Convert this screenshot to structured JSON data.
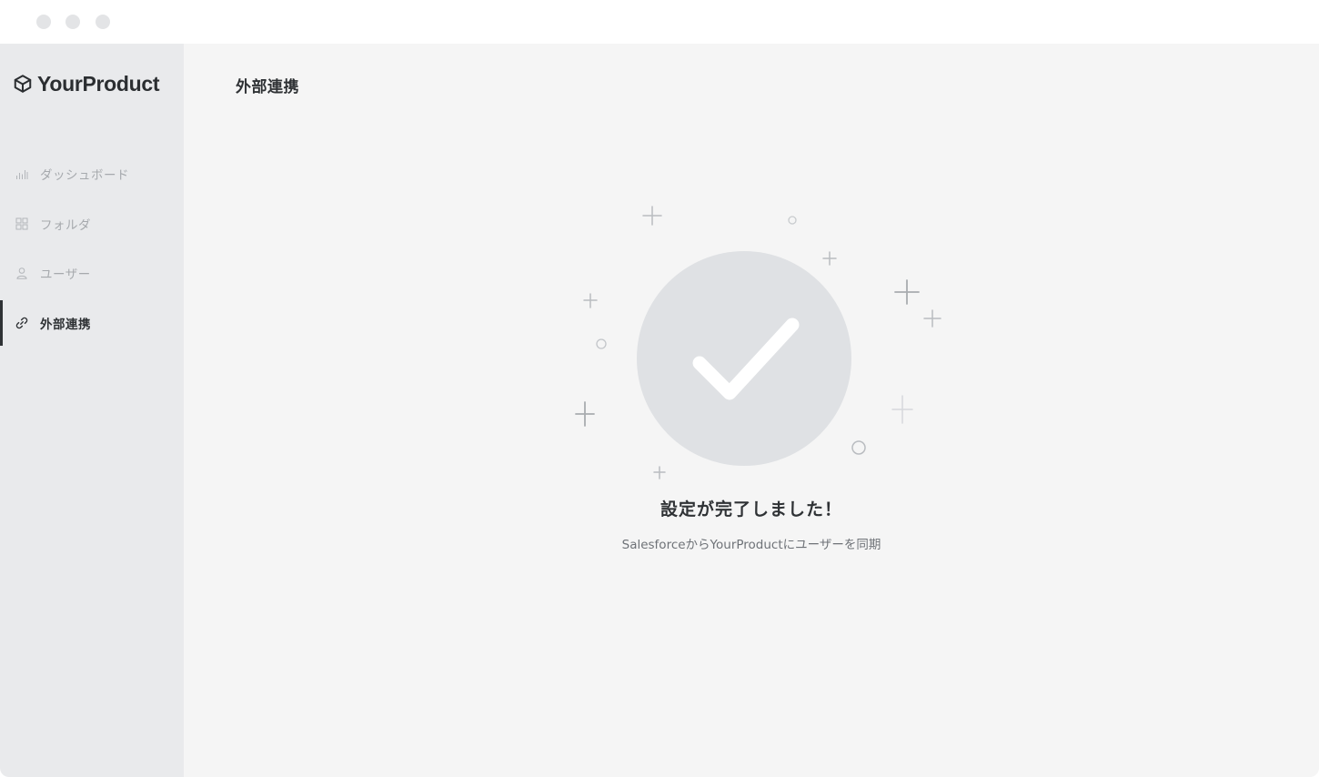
{
  "window": {
    "controls": [
      "close",
      "minimize",
      "maximize"
    ]
  },
  "sidebar": {
    "logo_icon": "cube-icon",
    "logo_text": "YourProduct",
    "items": [
      {
        "label": "ダッシュボード",
        "icon": "bar-chart-icon",
        "active": false
      },
      {
        "label": "フォルダ",
        "icon": "grid-icon",
        "active": false
      },
      {
        "label": "ユーザー",
        "icon": "user-icon",
        "active": false
      },
      {
        "label": "外部連携",
        "icon": "link-icon",
        "active": true
      }
    ]
  },
  "main": {
    "page_title": "外部連携",
    "status": {
      "icon": "checkmark-icon",
      "title": "設定が完了しました！",
      "subtitle": "SalesforceからYourProductにユーザーを同期"
    }
  },
  "colors": {
    "sidebar_bg": "#e9eaec",
    "main_bg": "#f5f5f5",
    "accent": "#2f3235",
    "check_circle": "#dfe1e4"
  }
}
